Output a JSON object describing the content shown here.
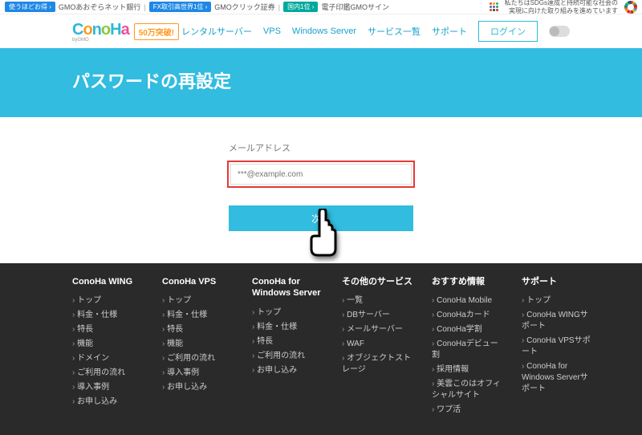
{
  "topbar": {
    "items": [
      {
        "badge": "使うほどお得 ›",
        "text": "GMOあおぞらネット銀行"
      },
      {
        "badge": "FX取引高世界1位 ›",
        "text": "GMOクリック証券"
      },
      {
        "badge": "国内1位 ›",
        "text": "電子印鑑GMOサイン"
      }
    ],
    "sdgs_text_line1": "私たちはSDGs達成と持続可能な社会の",
    "sdgs_text_line2": "実現に向けた取り組みを進めています"
  },
  "header": {
    "promo": "50万突破!",
    "nav": {
      "rental": "レンタルサーバー",
      "vps": "VPS",
      "windows": "Windows Server",
      "services": "サービス一覧",
      "support": "サポート"
    },
    "login": "ログイン"
  },
  "hero": {
    "title": "パスワードの再設定"
  },
  "form": {
    "label": "メールアドレス",
    "placeholder": "***@example.com",
    "next": "次へ"
  },
  "footer": {
    "cols": [
      {
        "title": "ConoHa WING",
        "links": [
          "トップ",
          "料金・仕様",
          "特長",
          "機能",
          "ドメイン",
          "ご利用の流れ",
          "導入事例",
          "お申し込み"
        ]
      },
      {
        "title": "ConoHa VPS",
        "links": [
          "トップ",
          "料金・仕様",
          "特長",
          "機能",
          "ご利用の流れ",
          "導入事例",
          "お申し込み"
        ]
      },
      {
        "title": "ConoHa for Windows Server",
        "links": [
          "トップ",
          "料金・仕様",
          "特長",
          "ご利用の流れ",
          "お申し込み"
        ]
      },
      {
        "title": "その他のサービス",
        "links": [
          "一覧",
          "DBサーバー",
          "メールサーバー",
          "WAF",
          "オブジェクトストレージ"
        ]
      },
      {
        "title": "おすすめ情報",
        "links": [
          "ConoHa Mobile",
          "ConoHaカード",
          "ConoHa学割",
          "ConoHaデビュー割",
          "採用情報",
          "美雲このはオフィシャルサイト",
          "ワプ活"
        ]
      },
      {
        "title": "サポート",
        "links": [
          "トップ",
          "ConoHa WINGサポート",
          "ConoHa VPSサポート",
          "ConoHa for Windows Serverサポート"
        ]
      }
    ]
  }
}
